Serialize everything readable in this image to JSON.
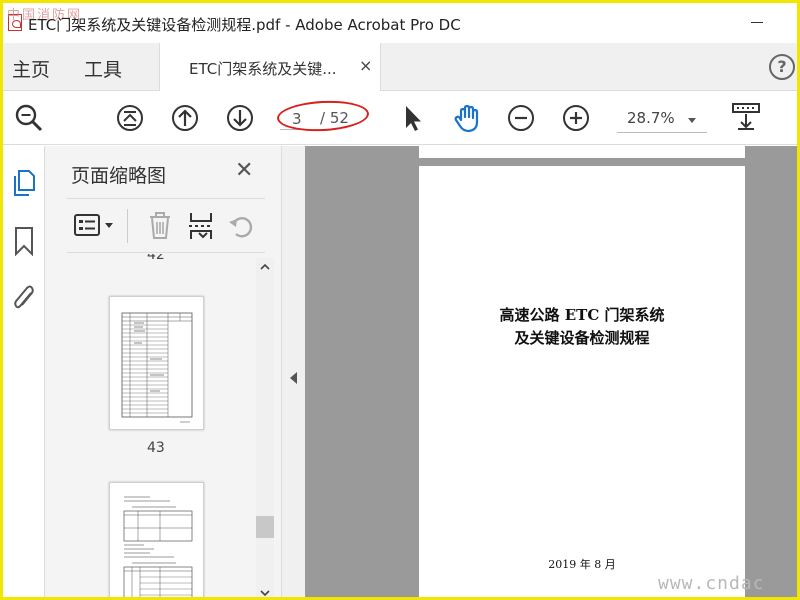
{
  "window": {
    "title": "ETC门架系统及关键设备检测规程.pdf - Adobe Acrobat Pro DC"
  },
  "watermarks": {
    "top_left": "中国消防网",
    "bottom_right": "www.cndac"
  },
  "nav": {
    "home": "主页",
    "tools": "工具"
  },
  "doc_tab": {
    "label": "ETC门架系统及关键...",
    "close": "×"
  },
  "toolbar": {
    "current_page": "3",
    "total_pages": "/ 52",
    "zoom": "28.7%"
  },
  "panel": {
    "title": "页面缩略图",
    "close": "✕",
    "thumbnails": [
      {
        "label": "42"
      },
      {
        "label": "43"
      }
    ]
  },
  "document": {
    "title_line1": "高速公路 ETC 门架系统",
    "title_line2": "及关键设备检测规程",
    "date": "2019 年 8 月"
  },
  "colors": {
    "annotation_ellipse": "#d8211d",
    "accent_blue": "#1a73c8",
    "frame": "#f2e600",
    "viewer_bg": "#9a9a9a"
  }
}
